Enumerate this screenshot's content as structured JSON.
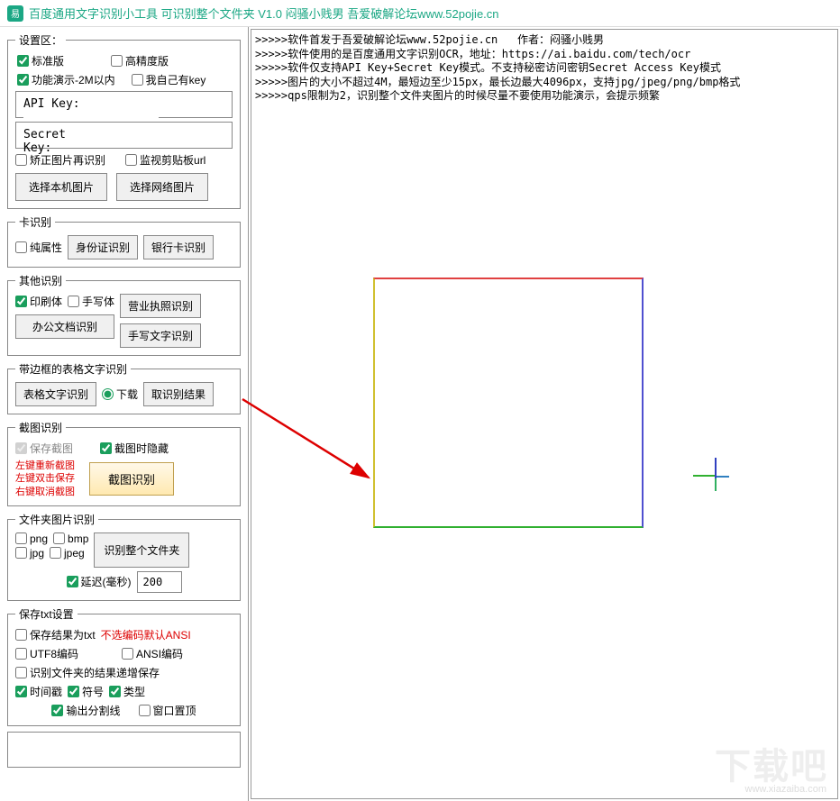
{
  "title": "百度通用文字识别小工具 可识别整个文件夹 V1.0  闷骚小贱男   吾爱破解论坛www.52pojie.cn",
  "logo_char": "易",
  "settings": {
    "legend": "设置区：",
    "standard": "标准版",
    "high_precision": "高精度版",
    "demo": "功能演示-2M以内",
    "own_key": "我自己有key",
    "api_key_label": "API Key:",
    "secret_key_label": "Secret Key:",
    "correct_rerecog": "矫正图片再识别",
    "monitor_clipboard": "监视剪贴板url",
    "select_local": "选择本机图片",
    "select_network": "选择网络图片"
  },
  "card": {
    "legend": "卡识别",
    "pure_attr": "纯属性",
    "id_card": "身份证识别",
    "bank_card": "银行卡识别"
  },
  "other": {
    "legend": "其他识别",
    "print": "印刷体",
    "handwrite_cb": "手写体",
    "license": "营业执照识别",
    "office_doc": "办公文档识别",
    "handwrite_btn": "手写文字识别"
  },
  "table": {
    "legend": "带边框的表格文字识别",
    "table_btn": "表格文字识别",
    "download": "下载",
    "get_result": "取识别结果"
  },
  "screenshot": {
    "legend": "截图识别",
    "save_shot": "保存截图",
    "hide_on_shot": "截图时隐藏",
    "hint_l1": "左键重新截图",
    "hint_l2": "左键双击保存",
    "hint_l3": "右键取消截图",
    "shot_btn": "截图识别"
  },
  "folder": {
    "legend": "文件夹图片识别",
    "png": "png",
    "bmp": "bmp",
    "jpg": "jpg",
    "jpeg": "jpeg",
    "recog_folder": "识别整个文件夹",
    "delay_label": "延迟(毫秒)",
    "delay_value": "200"
  },
  "txt": {
    "legend": "保存txt设置",
    "save_as_txt": "保存结果为txt",
    "hint": "不选编码默认ANSI",
    "utf8": "UTF8编码",
    "ansi": "ANSI编码",
    "append": "识别文件夹的结果递增保存",
    "timestamp": "时间戳",
    "symbol": "符号",
    "type": "类型",
    "sep_line": "输出分割线",
    "top_window": "窗口置顶"
  },
  "output": {
    "l1": ">>>>>软件首发于吾爱破解论坛www.52pojie.cn   作者：闷骚小贱男",
    "l2": ">>>>>软件使用的是百度通用文字识别OCR，地址：https://ai.baidu.com/tech/ocr",
    "l3": ">>>>>软件仅支持API Key+Secret Key模式。不支持秘密访问密钥Secret Access Key模式",
    "l4": ">>>>>图片的大小不超过4M，最短边至少15px，最长边最大4096px，支持jpg/jpeg/png/bmp格式",
    "l5": ">>>>>qps限制为2，识别整个文件夹图片的时候尽量不要使用功能演示，会提示频繁"
  },
  "watermark": "下载吧",
  "watermark_url": "www.xiazaiba.com"
}
